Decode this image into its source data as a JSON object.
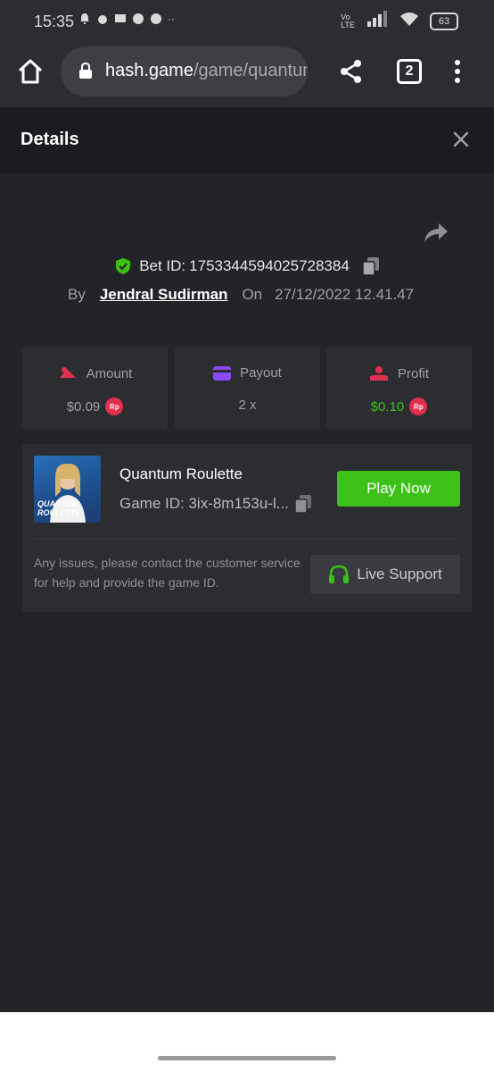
{
  "status_bar": {
    "time": "15:35",
    "battery": "63",
    "network": "4G"
  },
  "browser": {
    "url_host": "hash.game",
    "url_path": "/game/quantum",
    "tabs_count": "2"
  },
  "details": {
    "title": "Details"
  },
  "bet": {
    "label": "Bet ID:",
    "id": "1753344594025728384",
    "by_label": "By",
    "user": "Jendral Sudirman",
    "on_label": "On",
    "date": "27/12/2022 12.41.47"
  },
  "stats": {
    "amount_label": "Amount",
    "amount_value": "$0.09",
    "payout_label": "Payout",
    "payout_value": "2 x",
    "profit_label": "Profit",
    "profit_value": "$0.10",
    "currency_badge": "Rp"
  },
  "game": {
    "name": "Quantum Roulette",
    "id_text": "Game ID: 3ix-8m153u-l...",
    "thumb_line1": "QUANTUM",
    "thumb_line2": "ROULETTE",
    "play_label": "Play Now",
    "help_text": "Any issues, please contact the customer service for help and provide the game ID.",
    "support_label": "Live Support"
  },
  "colors": {
    "accent_green": "#3bc117",
    "badge_red": "#e0304e",
    "background": "#232427"
  }
}
